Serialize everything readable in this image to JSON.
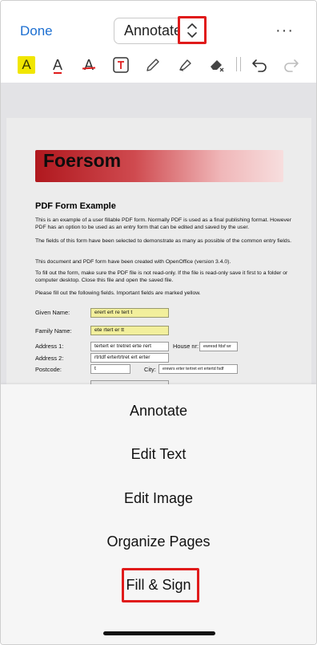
{
  "header": {
    "done_label": "Done",
    "mode_value": "Annotate",
    "more_label": "···"
  },
  "toolbar": {
    "highlight_label": "A",
    "font_color_label": "A",
    "strikethrough_label": "A",
    "icons": [
      "highlight-text-icon",
      "text-color-icon",
      "strikethrough-icon",
      "text-box-icon",
      "pencil-icon",
      "highlighter-icon",
      "eraser-icon",
      "undo-icon",
      "redo-icon"
    ]
  },
  "document": {
    "banner_title": "Foersom",
    "title": "PDF Form Example",
    "paragraphs": [
      "This is an example of a user fillable PDF form. Normally PDF is used as a final publishing format. However PDF has an option to be used as an entry form that can be edited and saved by the user.",
      "The fields of this form have been selected to demonstrate as many as possible of the common entry fields.",
      "This document and PDF form have been created with OpenOffice (version 3.4.0).",
      "To fill out the form, make sure the PDF file is not read-only. If the file is read-only save it first to a folder or computer desktop. Close this file and open the saved file.",
      "Please fill out the following fields. Important fields are marked yellow."
    ],
    "form": {
      "given_name_label": "Given Name:",
      "given_name_value": "erert ert re tert t",
      "family_name_label": "Family Name:",
      "family_name_value": "ete rtert er tt",
      "address1_label": "Address 1:",
      "address1_value": "tertert er tretret  erte rert",
      "house_nr_label": "House nr:",
      "house_nr_value": "ewresd fdsf wr",
      "address2_label": "Address 2:",
      "address2_value": "rtrtdf ertertrtret ert erter",
      "postcode_label": "Postcode:",
      "postcode_value": "t",
      "city_label": "City:",
      "city_value": "erewrs erter tertret ert ertertd fsdf"
    }
  },
  "sheet": {
    "options": [
      "Annotate",
      "Edit Text",
      "Edit Image",
      "Organize Pages",
      "Fill & Sign"
    ]
  },
  "colors": {
    "accent": "#1d6fd1",
    "highlight_box": "#e01b1b",
    "yellow_field": "#f2ef9c"
  }
}
